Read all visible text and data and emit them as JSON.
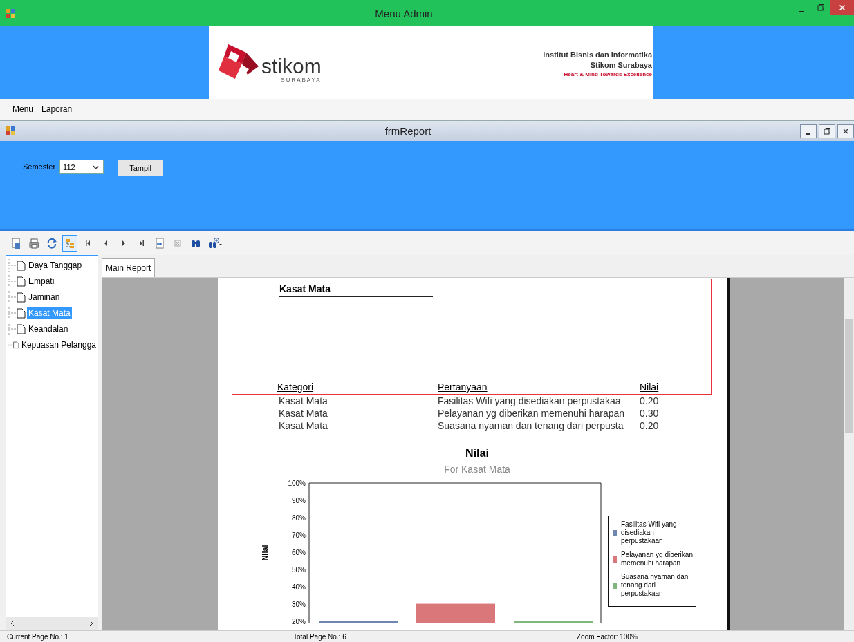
{
  "window": {
    "title": "Menu Admin"
  },
  "banner": {
    "logo_text": "stikom",
    "logo_subtext": "SURABAYA",
    "lines": [
      "Institut Bisnis dan Informatika",
      "Stikom Surabaya",
      "Heart & Mind Towards Excellence"
    ]
  },
  "menu": [
    "Menu",
    "Laporan"
  ],
  "child_window": {
    "title": "frmReport"
  },
  "filter": {
    "label": "Semester",
    "value": "112",
    "button": "Tampil"
  },
  "toolbar": [
    {
      "kind": "export",
      "selected": false
    },
    {
      "kind": "print",
      "selected": false
    },
    {
      "kind": "refresh",
      "selected": false
    },
    {
      "kind": "tree",
      "selected": true
    },
    {
      "kind": "first",
      "selected": false
    },
    {
      "kind": "prev",
      "selected": false
    },
    {
      "kind": "next",
      "selected": false
    },
    {
      "kind": "last",
      "selected": false
    },
    {
      "kind": "goto",
      "selected": false
    },
    {
      "kind": "stop",
      "selected": false
    },
    {
      "kind": "find",
      "selected": false
    },
    {
      "kind": "zoom",
      "selected": false
    }
  ],
  "tree": {
    "items": [
      {
        "label": "Daya Tanggap",
        "selected": false
      },
      {
        "label": "Empati",
        "selected": false
      },
      {
        "label": "Jaminan",
        "selected": false
      },
      {
        "label": "Kasat Mata",
        "selected": true
      },
      {
        "label": "Keandalan",
        "selected": false
      },
      {
        "label": "Kepuasan Pelangga",
        "selected": false
      }
    ]
  },
  "tabs": [
    {
      "label": "Main Report",
      "selected": true
    }
  ],
  "report": {
    "heading": "Kasat Mata",
    "columns": [
      "Kategori",
      "Pertanyaan",
      "Nilai"
    ],
    "rows": [
      [
        "Kasat Mata",
        "Fasilitas Wifi yang disediakan perpustakaa",
        "0.20"
      ],
      [
        "Kasat Mata",
        "Pelayanan yg diberikan memenuhi harapan",
        "0.30"
      ],
      [
        "Kasat Mata",
        "Suasana nyaman dan tenang dari perpusta",
        "0.20"
      ]
    ],
    "chart_subtitle": "For Kasat Mata",
    "chart_data": {
      "type": "bar",
      "title": "Nilai",
      "ylabel": "Nilai",
      "ylim": [
        19,
        100
      ],
      "legend": true,
      "yticks": [
        {
          "value": 20,
          "label": "20%"
        },
        {
          "value": 30,
          "label": "30%"
        },
        {
          "value": 40,
          "label": "40%"
        },
        {
          "value": 50,
          "label": "50%"
        },
        {
          "value": 60,
          "label": "60%"
        },
        {
          "value": 70,
          "label": "70%"
        },
        {
          "value": 80,
          "label": "80%"
        },
        {
          "value": 90,
          "label": "90%"
        },
        {
          "value": 100,
          "label": "100%"
        }
      ],
      "series": [
        {
          "name": "Fasilitas Wifi yang disediakan perpustakaan",
          "color": "#6f87b0",
          "values": [
            20
          ]
        },
        {
          "name": "Pelayanan yg diberikan memenuhi harapan",
          "color": "#d9777a",
          "values": [
            30
          ]
        },
        {
          "name": "Suasana nyaman dan tenang dari perpustakaan",
          "color": "#7fb77e",
          "values": [
            20
          ]
        }
      ]
    }
  },
  "status_bar": [
    "Current Page No.: 1",
    "Total Page No.: 6",
    "Zoom Factor: 100%"
  ]
}
